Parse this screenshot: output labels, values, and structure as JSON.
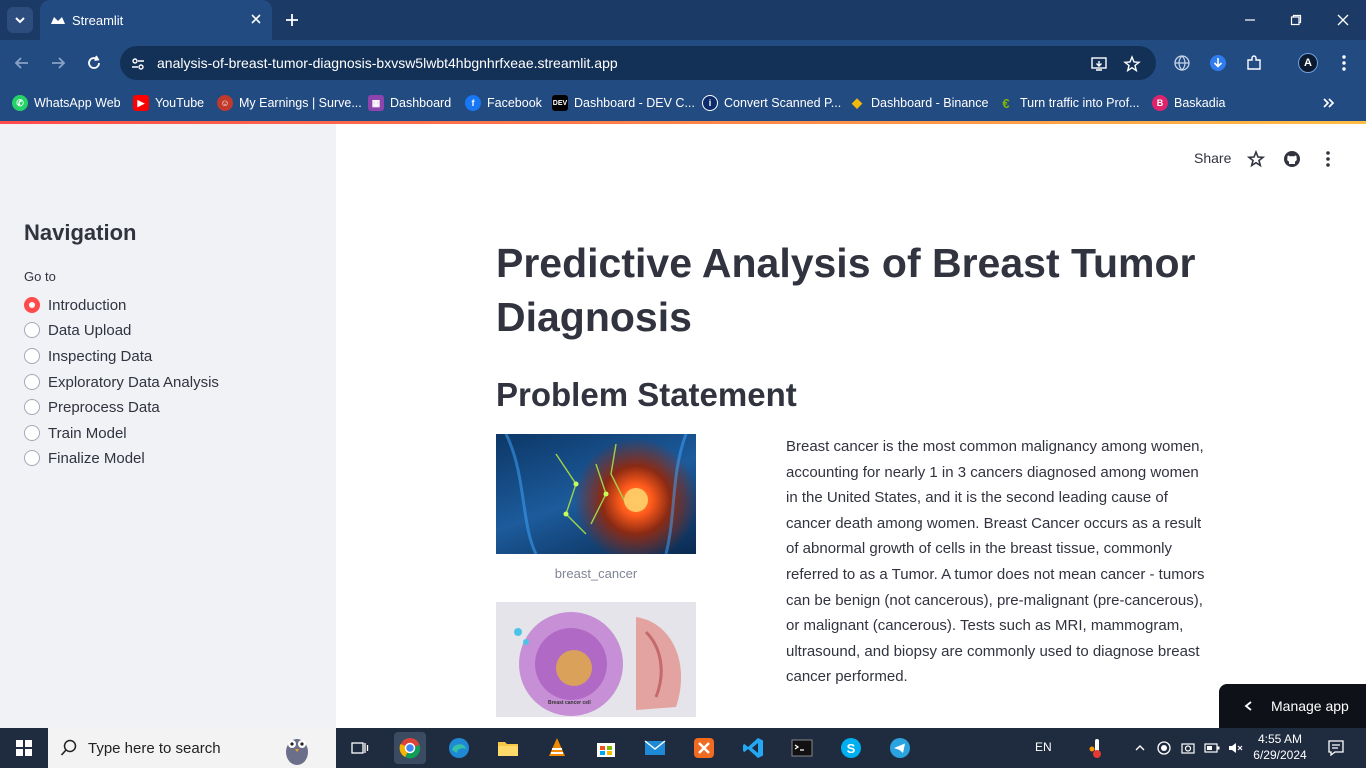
{
  "browser": {
    "tab_title": "Streamlit",
    "url": "analysis-of-breast-tumor-diagnosis-bxvsw5lwbt4hbgnhrfxeae.streamlit.app",
    "avatar_letter": "A",
    "bookmarks": [
      {
        "label": "WhatsApp Web",
        "icon": "whatsapp-icon",
        "color": "#25d366"
      },
      {
        "label": "YouTube",
        "icon": "youtube-icon",
        "color": "#ff0000"
      },
      {
        "label": "My Earnings | Surve...",
        "icon": "earnings-icon",
        "color": "#c0392b"
      },
      {
        "label": "Dashboard",
        "icon": "dashboard-icon",
        "color": "#8e44ad"
      },
      {
        "label": "Facebook",
        "icon": "facebook-icon",
        "color": "#1877f2"
      },
      {
        "label": "Dashboard - DEV C...",
        "icon": "dev-icon",
        "color": "#000000"
      },
      {
        "label": "Convert Scanned P...",
        "icon": "convert-icon",
        "color": "#0d2b6b"
      },
      {
        "label": "Dashboard - Binance",
        "icon": "binance-icon",
        "color": "#f0b90b"
      },
      {
        "label": "Turn traffic into Prof...",
        "icon": "traffic-icon",
        "color": "#7fb800"
      },
      {
        "label": "Baskadia",
        "icon": "baskadia-icon",
        "color": "#e0246c"
      }
    ]
  },
  "sidebar": {
    "title": "Navigation",
    "goto_label": "Go to",
    "options": [
      {
        "label": "Introduction",
        "selected": true
      },
      {
        "label": "Data Upload",
        "selected": false
      },
      {
        "label": "Inspecting Data",
        "selected": false
      },
      {
        "label": "Exploratory Data Analysis",
        "selected": false
      },
      {
        "label": "Preprocess Data",
        "selected": false
      },
      {
        "label": "Train Model",
        "selected": false
      },
      {
        "label": "Finalize Model",
        "selected": false
      }
    ]
  },
  "header": {
    "share_label": "Share"
  },
  "main": {
    "title": "Predictive Analysis of Breast Tumor Diagnosis",
    "section_title": "Problem Statement",
    "image1_caption": "breast_cancer",
    "image2_label": "Breast cancer cell",
    "paragraph": "Breast cancer is the most common malignancy among women, accounting for nearly 1 in 3 cancers diagnosed among women in the United States, and it is the second leading cause of cancer death among women. Breast Cancer occurs as a result of abnormal growth of cells in the breast tissue, commonly referred to as a Tumor. A tumor does not mean cancer - tumors can be benign (not cancerous), pre-malignant (pre-cancerous), or malignant (cancerous). Tests such as MRI, mammogram, ultrasound, and biopsy are commonly used to diagnose breast cancer performed."
  },
  "manage_app": {
    "label": "Manage app"
  },
  "taskbar": {
    "search_placeholder": "Type here to search",
    "language": "EN",
    "time": "4:55 AM",
    "date": "6/29/2024"
  },
  "colors": {
    "accent": "#ff4b4b",
    "chrome_bg": "#224b82",
    "sidebar_bg": "#f0f2f6",
    "text": "#31333f"
  }
}
